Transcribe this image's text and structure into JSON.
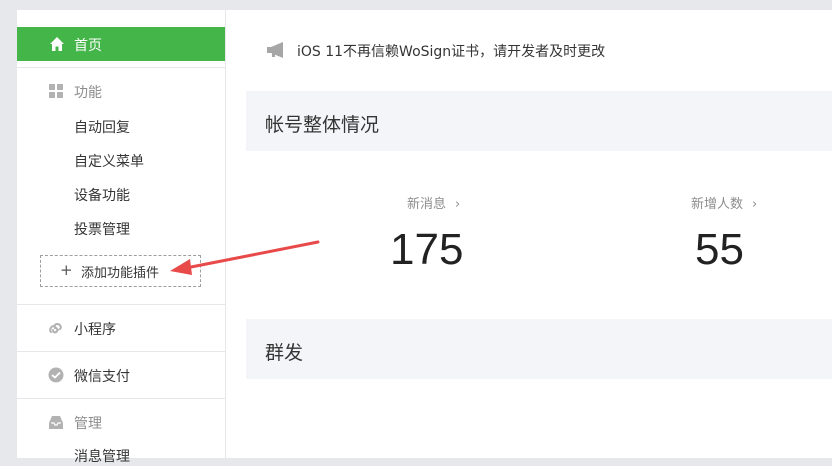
{
  "sidebar": {
    "home_label": "首页",
    "feature_section": {
      "title": "功能",
      "items": [
        "自动回复",
        "自定义菜单",
        "设备功能",
        "投票管理"
      ],
      "add_plugin": "添加功能插件"
    },
    "mini_program": "小程序",
    "wechat_pay": "微信支付",
    "manage_section": {
      "title": "管理",
      "items": [
        "消息管理"
      ]
    }
  },
  "main": {
    "notice": "iOS 11不再信赖WoSign证书，请开发者及时更改",
    "account_section": {
      "title": "帐号整体情况",
      "stats": [
        {
          "label": "新消息",
          "value": "175"
        },
        {
          "label": "新增人数",
          "value": "55"
        }
      ]
    },
    "broadcast_section": {
      "title": "群发"
    }
  },
  "colors": {
    "accent": "#44b549",
    "annotation": "#e84a4a"
  }
}
